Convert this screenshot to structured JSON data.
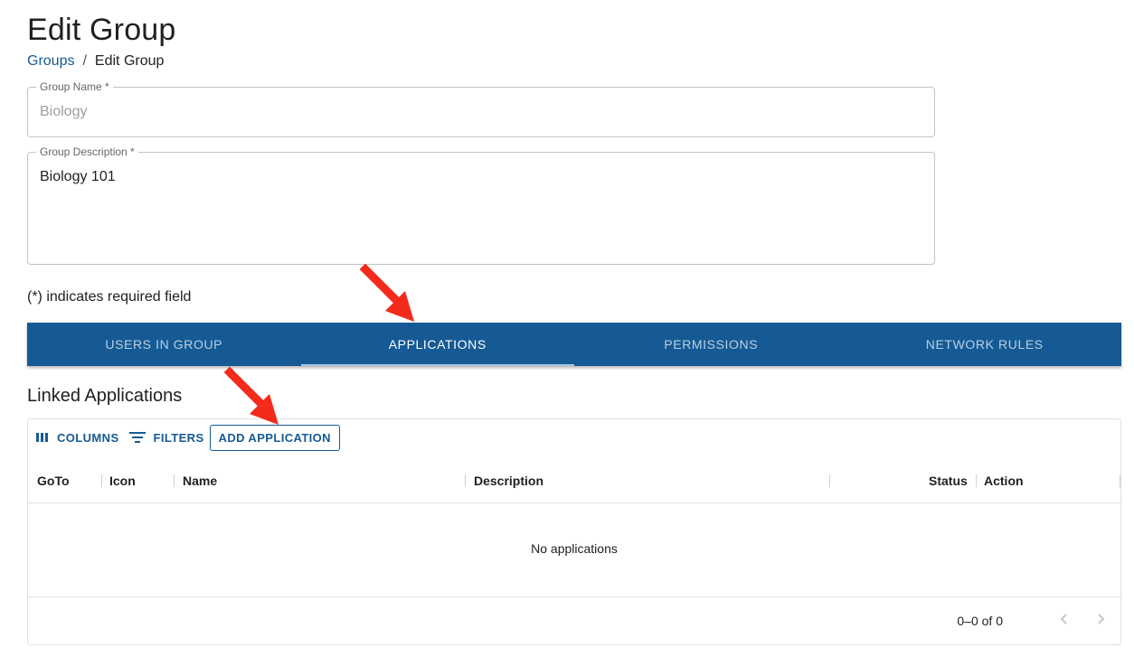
{
  "page": {
    "title": "Edit Group",
    "breadcrumb": {
      "link": "Groups",
      "separator": "/",
      "current": "Edit Group"
    }
  },
  "form": {
    "group_name": {
      "label": "Group Name *",
      "value": "Biology"
    },
    "group_description": {
      "label": "Group Description *",
      "value": "Biology 101"
    },
    "required_note": "(*) indicates required field"
  },
  "tabs": [
    {
      "label": "USERS IN GROUP",
      "active": false
    },
    {
      "label": "APPLICATIONS",
      "active": true
    },
    {
      "label": "PERMISSIONS",
      "active": false
    },
    {
      "label": "NETWORK RULES",
      "active": false
    }
  ],
  "section": {
    "title": "Linked Applications",
    "toolbar": {
      "columns_label": "COLUMNS",
      "filters_label": "FILTERS",
      "add_label": "ADD APPLICATION"
    },
    "columns": [
      "GoTo",
      "Icon",
      "Name",
      "Description",
      "Status",
      "Action"
    ],
    "empty_text": "No applications",
    "pagination": "0–0 of 0"
  },
  "colors": {
    "primary": "#155a95",
    "annotation_arrow": "#f42a1a"
  },
  "icons": {
    "columns": "columns-icon",
    "filters": "filter-icon",
    "prev": "chevron-left-icon",
    "next": "chevron-right-icon"
  }
}
